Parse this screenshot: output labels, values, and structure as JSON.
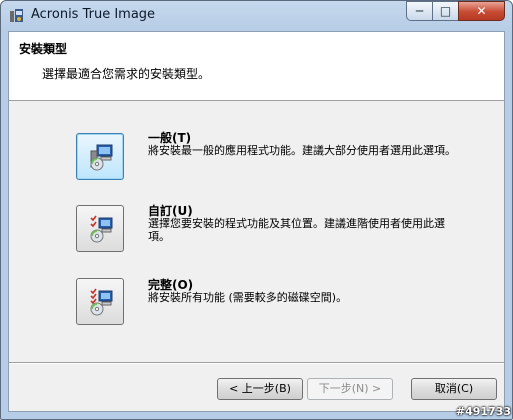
{
  "window": {
    "title": "Acronis True Image"
  },
  "title_controls": {
    "minimize": "─",
    "maximize": "□",
    "close": "✕"
  },
  "header": {
    "title": "安裝類型",
    "subtitle": "選擇最適合您需求的安裝類型。"
  },
  "options": [
    {
      "title": "一般(T)",
      "description": "將安裝最一般的應用程式功能。建議大部分使用者選用此選項。",
      "icon": "typical-setup-icon",
      "focused": true
    },
    {
      "title": "自訂(U)",
      "description": "選擇您要安裝的程式功能及其位置。建議進階使用者使用此選項。",
      "icon": "custom-setup-icon",
      "focused": false
    },
    {
      "title": "完整(O)",
      "description": "將安裝所有功能 (需要較多的磁碟空間)。",
      "icon": "complete-setup-icon",
      "focused": false
    }
  ],
  "buttons": {
    "back": "< 上一步(B)",
    "next": "下一步(N) >",
    "cancel": "取消(C)"
  },
  "watermark": "#491733",
  "colors": {
    "focus_border": "#3c7fb1",
    "close_button": "#c74a32"
  }
}
